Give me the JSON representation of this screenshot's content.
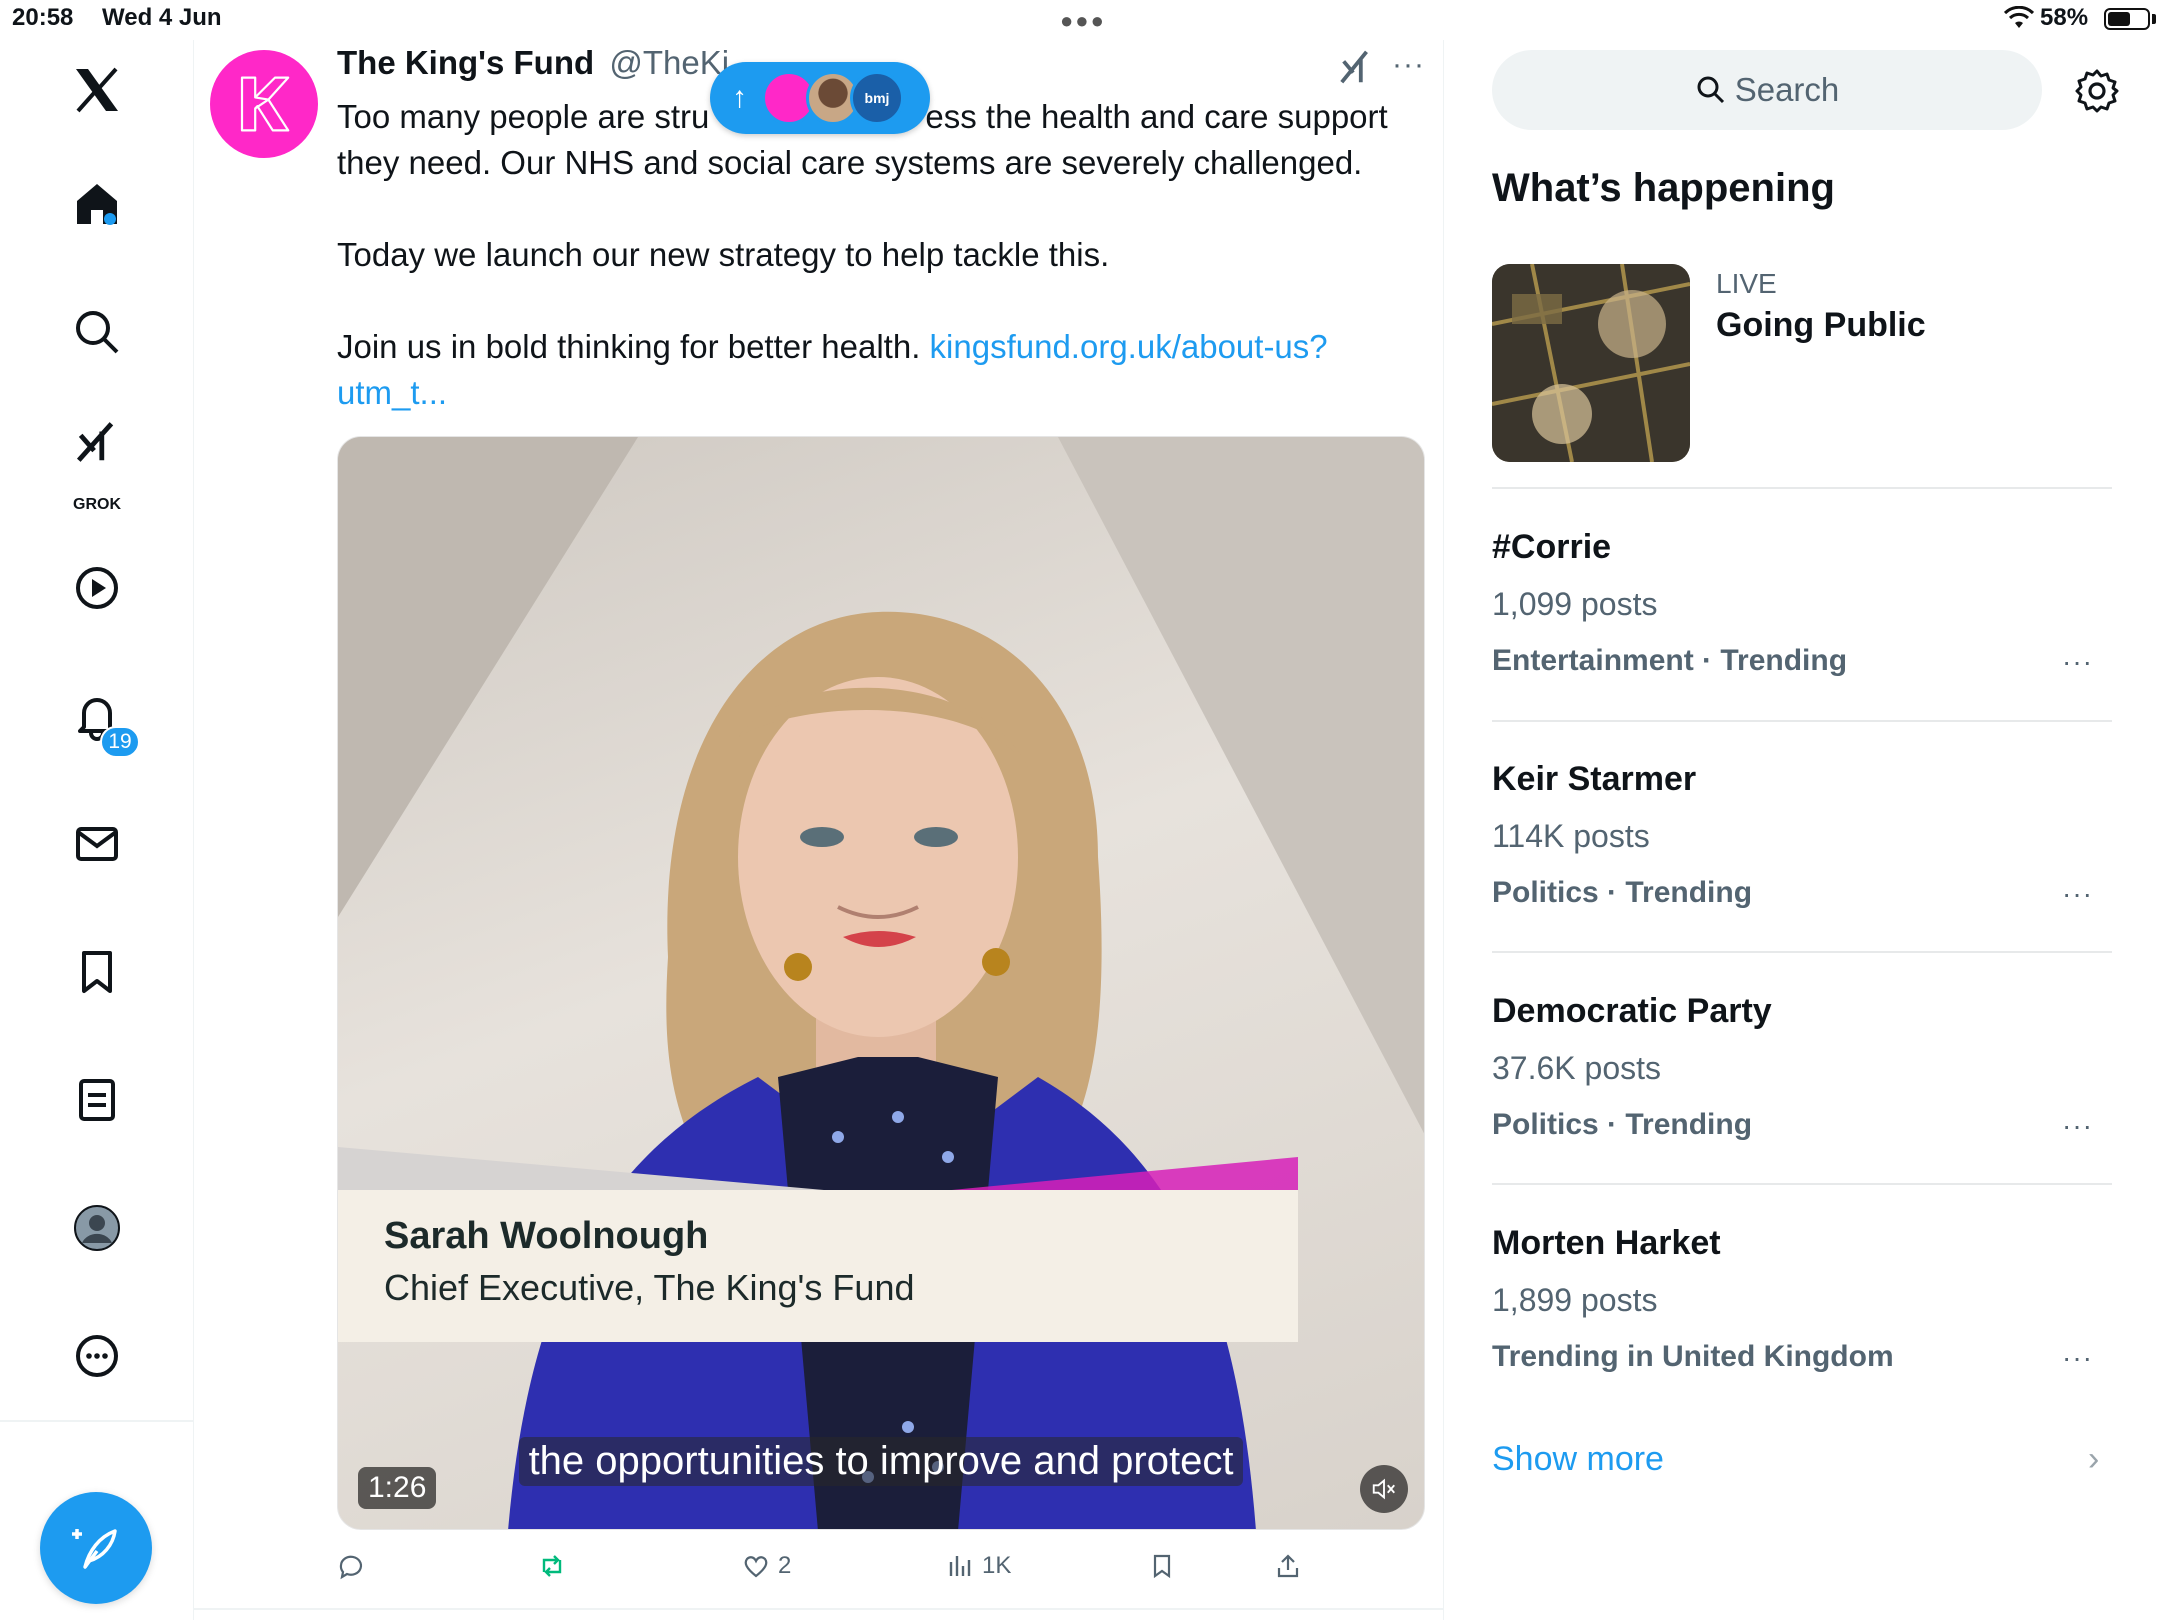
{
  "status_bar": {
    "time": "20:58",
    "date": "Wed 4 Jun",
    "battery": "58%"
  },
  "nav": {
    "notifications_count": "19",
    "grok_label": "GROK"
  },
  "tweet": {
    "name": "The King's Fund",
    "handle": "@TheKi",
    "text_1": "Too many people are stru",
    "text_1b": "ess the health and care support they need. Our NHS and social care systems are severely challenged.",
    "text_2": "Today we launch our new strategy to help tackle this.",
    "text_3": "Join us in bold thinking for better health. ",
    "link": "kingsfund.org.uk/about-us?utm_t...",
    "video": {
      "speaker_name": "Sarah Woolnough",
      "speaker_title": "Chief Executive, The King's Fund",
      "caption": "the opportunities to improve and protect",
      "duration": "1:26"
    },
    "actions": {
      "likes": "2",
      "views": "1K"
    }
  },
  "new_posts_pill": {
    "avatar_3_text": "bmj"
  },
  "right": {
    "search_placeholder": "Search",
    "whats_happening": "What’s happening",
    "live": {
      "tag": "LIVE",
      "title": "Going Public"
    },
    "trends": [
      {
        "name": "#Corrie",
        "posts": "1,099 posts",
        "category": "Entertainment · Trending"
      },
      {
        "name": "Keir Starmer",
        "posts": "114K posts",
        "category": "Politics · Trending"
      },
      {
        "name": "Democratic Party",
        "posts": "37.6K posts",
        "category": "Politics · Trending"
      },
      {
        "name": "Morten Harket",
        "posts": "1,899 posts",
        "category": "Trending in United Kingdom"
      }
    ],
    "show_more": "Show more"
  },
  "colors": {
    "accent": "#1d9bf0",
    "kings_fund_pink": "#ff28c8",
    "secondary_text": "#536471",
    "retweet_green": "#00ba7c"
  }
}
